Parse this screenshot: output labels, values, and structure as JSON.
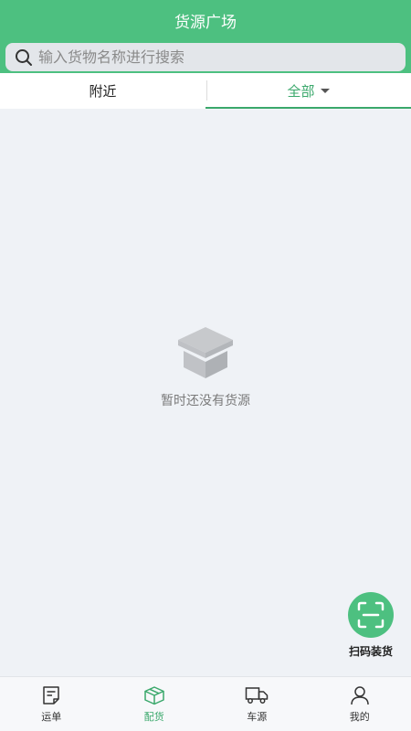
{
  "header": {
    "title": "货源广场"
  },
  "search": {
    "placeholder": "输入货物名称进行搜索",
    "icon": "search-icon"
  },
  "tabs": [
    {
      "label": "附近",
      "active": false
    },
    {
      "label": "全部",
      "active": true,
      "icon": "caret-down-icon"
    }
  ],
  "empty_state": {
    "icon": "empty-box-icon",
    "text": "暂时还没有货源"
  },
  "scan_button": {
    "label": "扫码装货",
    "icon": "scan-icon",
    "color": "#4dc080"
  },
  "bottom_nav": {
    "items": [
      {
        "label": "运单",
        "icon": "waybill-icon",
        "active": false
      },
      {
        "label": "配货",
        "icon": "box-icon",
        "active": true
      },
      {
        "label": "车源",
        "icon": "truck-icon",
        "active": false
      },
      {
        "label": "我的",
        "icon": "user-icon",
        "active": false
      }
    ]
  },
  "colors": {
    "accent": "#4dc080",
    "active_text": "#3aa86b",
    "background": "#eff2f6"
  }
}
